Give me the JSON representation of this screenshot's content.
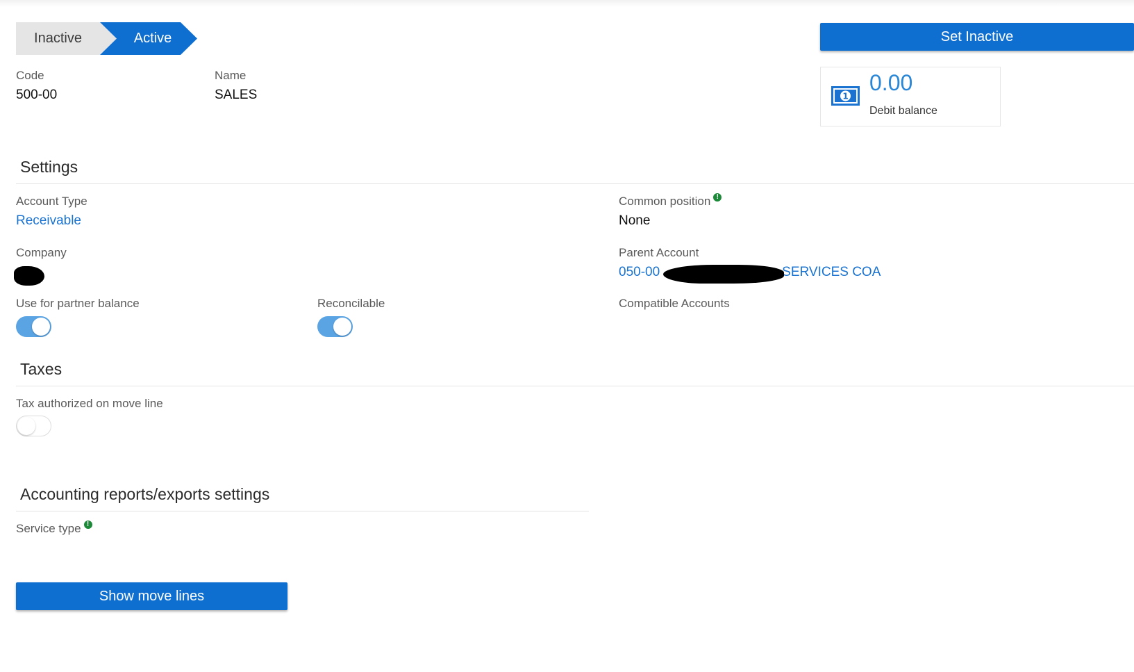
{
  "status_steps": [
    {
      "label": "Inactive",
      "state": "inactive"
    },
    {
      "label": "Active",
      "state": "current"
    }
  ],
  "actions": {
    "set_inactive_label": "Set Inactive",
    "show_move_lines_label": "Show move lines"
  },
  "header": {
    "code_label": "Code",
    "code_value": "500-00",
    "name_label": "Name",
    "name_value": "SALES"
  },
  "balance": {
    "amount": "0.00",
    "label": "Debit balance",
    "icon": "money-bill-icon"
  },
  "settings": {
    "title": "Settings",
    "account_type_label": "Account Type",
    "account_type_value": "Receivable",
    "common_position_label": "Common position",
    "common_position_value": "None",
    "company_label": "Company",
    "parent_account_label": "Parent Account",
    "parent_account_prefix": "050-00",
    "parent_account_suffix": "SERVICES COA",
    "partner_balance_label": "Use for partner balance",
    "partner_balance_on": true,
    "reconcilable_label": "Reconcilable",
    "reconcilable_on": true,
    "compatible_accounts_label": "Compatible Accounts"
  },
  "taxes": {
    "title": "Taxes",
    "tax_authorized_label": "Tax authorized on move line",
    "tax_authorized_on": false
  },
  "reports": {
    "title": "Accounting reports/exports settings",
    "service_type_label": "Service type"
  },
  "colors": {
    "primary": "#0f6fd1",
    "link": "#1a73d0",
    "toggle_on": "#5aa4e4",
    "info": "#1d8a3a"
  }
}
